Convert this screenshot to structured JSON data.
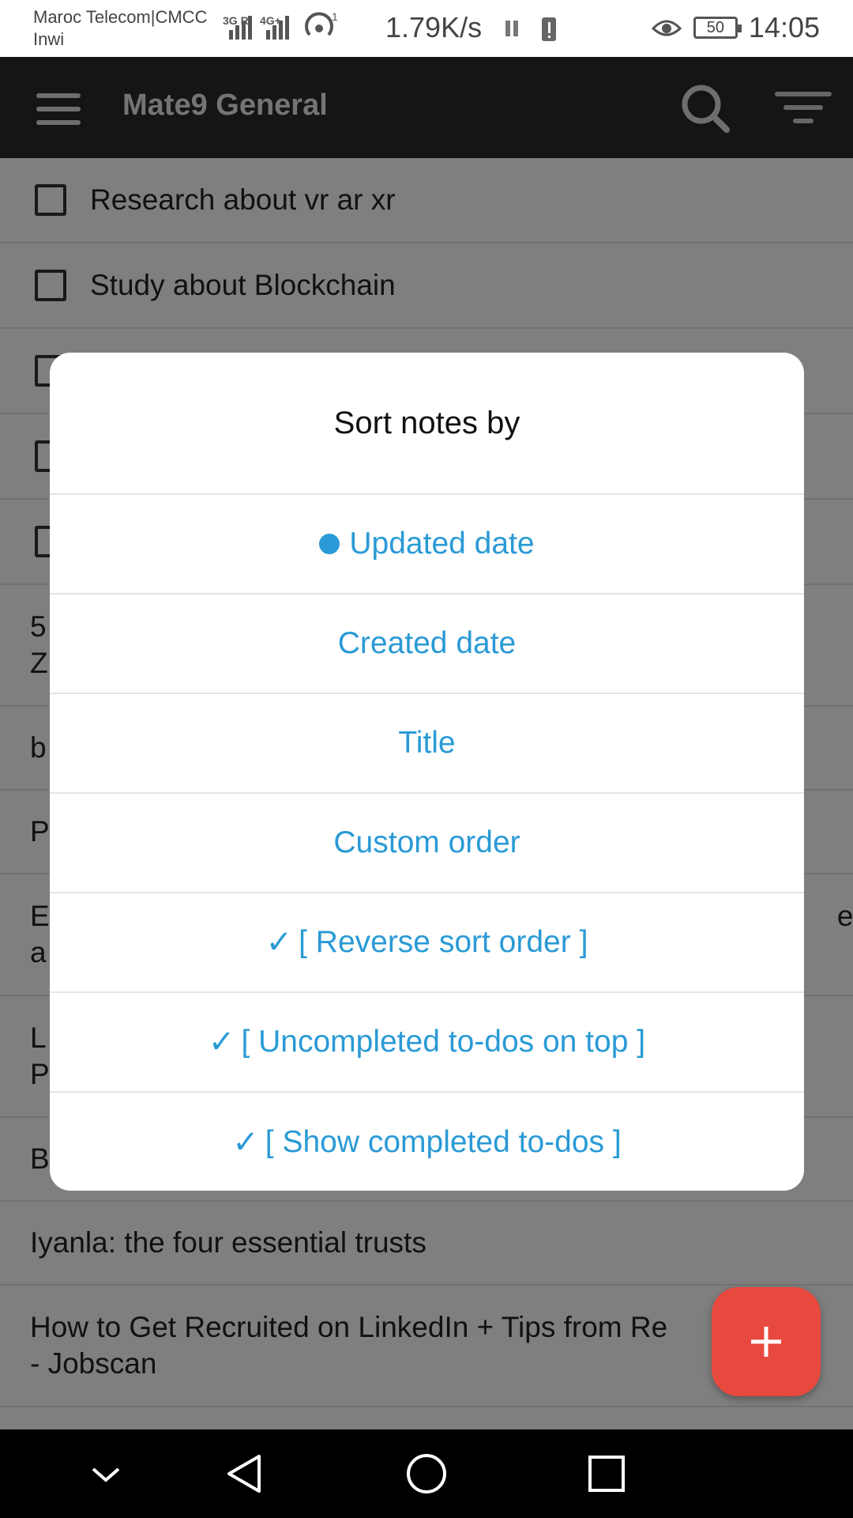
{
  "status_bar": {
    "carrier_line1": "Maroc Telecom|CMCC",
    "carrier_line2": "Inwi",
    "net1": "3G R",
    "net2": "4G+",
    "wifi_badge": "1",
    "speed": "1.79K/s",
    "battery": "50",
    "time": "14:05"
  },
  "app_bar": {
    "title": "Mate9 General",
    "menu_icon": "hamburger-menu-icon",
    "search_icon": "search-icon",
    "sort_icon": "sort-filter-icon"
  },
  "notes": [
    {
      "type": "todo",
      "text": "Research about vr ar xr"
    },
    {
      "type": "todo",
      "text": "Study about Blockchain"
    },
    {
      "type": "todo",
      "text": ""
    },
    {
      "type": "todo",
      "text": ""
    },
    {
      "type": "todo",
      "text": ""
    },
    {
      "type": "note-tall",
      "text": "5\nZ"
    },
    {
      "type": "note",
      "text": "b"
    },
    {
      "type": "note",
      "text": "P"
    },
    {
      "type": "note-tall",
      "text": "E                                                                                                 e\na"
    },
    {
      "type": "note-tall",
      "text": "L\nP"
    },
    {
      "type": "note",
      "text": "B"
    },
    {
      "type": "note",
      "text": "Iyanla: the four essential trusts"
    },
    {
      "type": "note-tall",
      "text": "How to Get Recruited on LinkedIn + Tips from Re\n- Jobscan"
    }
  ],
  "dialog": {
    "title": "Sort notes by",
    "options": [
      {
        "label": "Updated date",
        "prefix": "radio",
        "selected": true
      },
      {
        "label": "Created date",
        "prefix": ""
      },
      {
        "label": "Title",
        "prefix": ""
      },
      {
        "label": "Custom order",
        "prefix": ""
      },
      {
        "label": "[ Reverse sort order ]",
        "prefix": "✓"
      },
      {
        "label": "[ Uncompleted to-dos on top ]",
        "prefix": "✓"
      },
      {
        "label": "[ Show completed to-dos ]",
        "prefix": "✓"
      }
    ]
  },
  "fab": {
    "icon": "plus-icon"
  },
  "nav_bar": {
    "icons": [
      "chevron-down-icon",
      "back-triangle-icon",
      "home-circle-icon",
      "recents-square-icon"
    ]
  },
  "colors": {
    "app_bar": "#2a2b31",
    "accent": "#2a9ad6",
    "fab": "#e8493e",
    "scrim": "rgba(0,0,0,0.5)"
  }
}
